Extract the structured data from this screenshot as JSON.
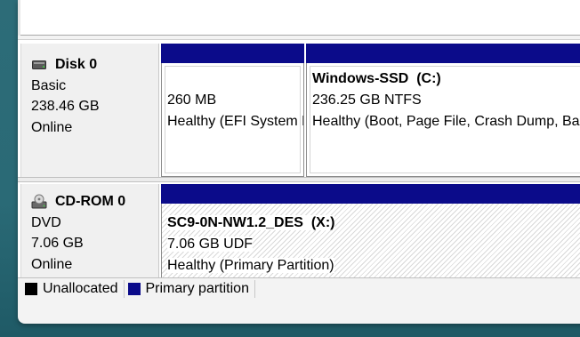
{
  "disks": [
    {
      "name": "Disk 0",
      "type": "Basic",
      "size": "238.46 GB",
      "status": "Online",
      "icon": "hard-disk-icon",
      "partitions": [
        {
          "name": "",
          "size": "260 MB",
          "status": "Healthy (EFI System Partition)"
        },
        {
          "name": "Windows-SSD  (C:)",
          "size": "236.25 GB NTFS",
          "status": "Healthy (Boot, Page File, Crash Dump, Basic Data Partition)"
        }
      ]
    },
    {
      "name": "CD-ROM 0",
      "type": "DVD",
      "size": "7.06 GB",
      "status": "Online",
      "icon": "cd-rom-icon",
      "partitions": [
        {
          "name": "SC9-0N-NW1.2_DES  (X:)",
          "size": "7.06 GB UDF",
          "status": "Healthy (Primary Partition)"
        }
      ]
    }
  ],
  "legend": [
    {
      "label": "Unallocated",
      "color": "#000000"
    },
    {
      "label": "Primary partition",
      "color": "#0b0b8a"
    }
  ]
}
